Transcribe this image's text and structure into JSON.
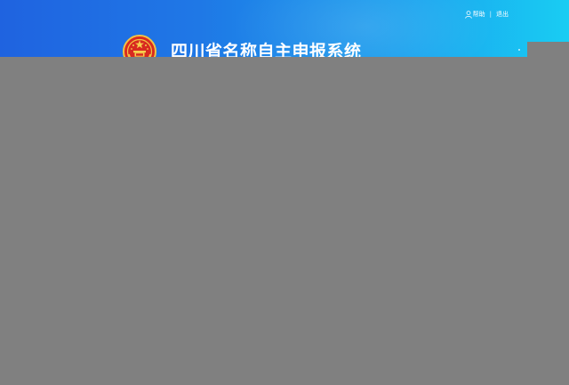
{
  "header": {
    "system_title": "四川省名称自主申报系统",
    "help_label": "帮助",
    "logout_label": "退出",
    "separator": "|",
    "emblem_icon": "national-emblem-icon",
    "user_icon": "user-icon"
  },
  "colors": {
    "banner_start": "#1f63e0",
    "banner_end": "#19cdf3",
    "overlay": "#808080"
  }
}
